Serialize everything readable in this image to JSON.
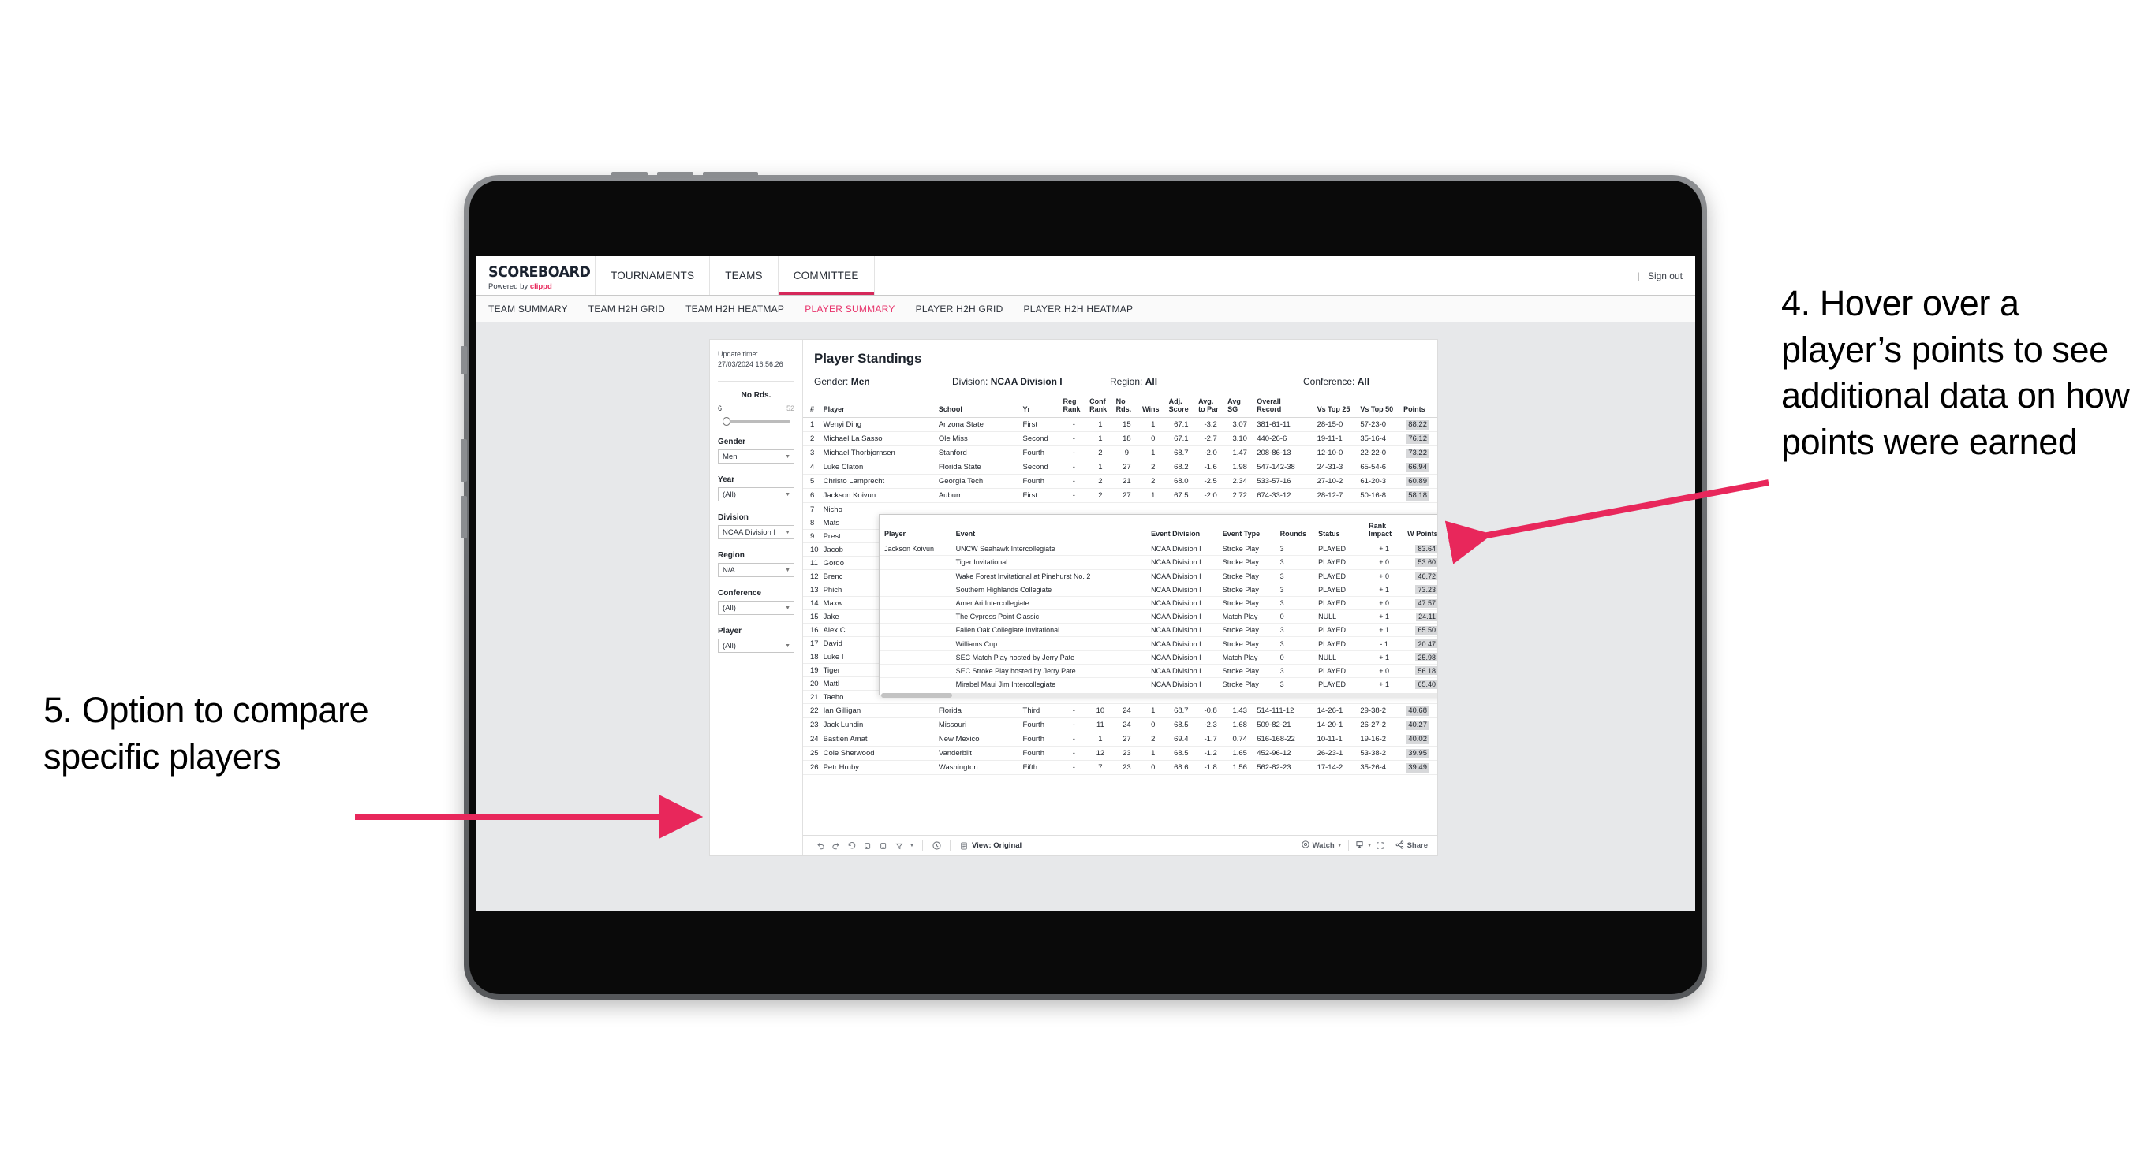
{
  "brand": {
    "title": "SCOREBOARD",
    "powered_prefix": "Powered by ",
    "powered_accent": "clippd"
  },
  "topnav": {
    "items": [
      {
        "label": "TOURNAMENTS",
        "active": false
      },
      {
        "label": "TEAMS",
        "active": false
      },
      {
        "label": "COMMITTEE",
        "active": true
      }
    ],
    "separator": "|",
    "sign_out": "Sign out"
  },
  "subnav": {
    "items": [
      {
        "label": "TEAM SUMMARY",
        "active": false
      },
      {
        "label": "TEAM H2H GRID",
        "active": false
      },
      {
        "label": "TEAM H2H HEATMAP",
        "active": false
      },
      {
        "label": "PLAYER SUMMARY",
        "active": true
      },
      {
        "label": "PLAYER H2H GRID",
        "active": false
      },
      {
        "label": "PLAYER H2H HEATMAP",
        "active": false
      }
    ]
  },
  "rail": {
    "update_time_label": "Update time:",
    "update_time_value": "27/03/2024 16:56:26",
    "slider": {
      "title": "No Rds.",
      "min": "6",
      "max": "52"
    },
    "filters": [
      {
        "label": "Gender",
        "value": "Men"
      },
      {
        "label": "Year",
        "value": "(All)"
      },
      {
        "label": "Division",
        "value": "NCAA Division I"
      },
      {
        "label": "Region",
        "value": "N/A"
      },
      {
        "label": "Conference",
        "value": "(All)"
      },
      {
        "label": "Player",
        "value": "(All)"
      }
    ]
  },
  "viz": {
    "title": "Player Standings",
    "filters": [
      {
        "label": "Gender:",
        "value": "Men"
      },
      {
        "label": "Division:",
        "value": "NCAA Division I"
      },
      {
        "label": "Region:",
        "value": "All"
      },
      {
        "label": "Conference:",
        "value": "All"
      }
    ]
  },
  "table": {
    "columns": [
      "#",
      "Player",
      "School",
      "Yr",
      "Reg\nRank",
      "Conf\nRank",
      "No\nRds.",
      "Wins",
      "Adj.\nScore",
      "Avg.\nto Par",
      "Avg\nSG",
      "Overall\nRecord",
      "Vs Top 25",
      "Vs Top 50",
      "Points"
    ],
    "rows": [
      {
        "rank": "1",
        "player": "Wenyi Ding",
        "school": "Arizona State",
        "yr": "First",
        "reg": "-",
        "conf": "1",
        "rds": "15",
        "wins": "1",
        "adj": "67.1",
        "par": "-3.2",
        "sg": "3.07",
        "record": "381-61-11",
        "t25": "28-15-0",
        "t50": "57-23-0",
        "points": "88.22"
      },
      {
        "rank": "2",
        "player": "Michael La Sasso",
        "school": "Ole Miss",
        "yr": "Second",
        "reg": "-",
        "conf": "1",
        "rds": "18",
        "wins": "0",
        "adj": "67.1",
        "par": "-2.7",
        "sg": "3.10",
        "record": "440-26-6",
        "t25": "19-11-1",
        "t50": "35-16-4",
        "points": "76.12"
      },
      {
        "rank": "3",
        "player": "Michael Thorbjornsen",
        "school": "Stanford",
        "yr": "Fourth",
        "reg": "-",
        "conf": "2",
        "rds": "9",
        "wins": "1",
        "adj": "68.7",
        "par": "-2.0",
        "sg": "1.47",
        "record": "208-86-13",
        "t25": "12-10-0",
        "t50": "22-22-0",
        "points": "73.22"
      },
      {
        "rank": "4",
        "player": "Luke Claton",
        "school": "Florida State",
        "yr": "Second",
        "reg": "-",
        "conf": "1",
        "rds": "27",
        "wins": "2",
        "adj": "68.2",
        "par": "-1.6",
        "sg": "1.98",
        "record": "547-142-38",
        "t25": "24-31-3",
        "t50": "65-54-6",
        "points": "66.94"
      },
      {
        "rank": "5",
        "player": "Christo Lamprecht",
        "school": "Georgia Tech",
        "yr": "Fourth",
        "reg": "-",
        "conf": "2",
        "rds": "21",
        "wins": "2",
        "adj": "68.0",
        "par": "-2.5",
        "sg": "2.34",
        "record": "533-57-16",
        "t25": "27-10-2",
        "t50": "61-20-3",
        "points": "60.89"
      },
      {
        "rank": "6",
        "player": "Jackson Koivun",
        "school": "Auburn",
        "yr": "First",
        "reg": "-",
        "conf": "2",
        "rds": "27",
        "wins": "1",
        "adj": "67.5",
        "par": "-2.0",
        "sg": "2.72",
        "record": "674-33-12",
        "t25": "28-12-7",
        "t50": "50-16-8",
        "points": "58.18"
      },
      {
        "rank": "7",
        "player": "Nicho",
        "school": "",
        "yr": "",
        "reg": "",
        "conf": "",
        "rds": "",
        "wins": "",
        "adj": "",
        "par": "",
        "sg": "",
        "record": "",
        "t25": "",
        "t50": "",
        "points": ""
      },
      {
        "rank": "8",
        "player": "Mats",
        "school": "",
        "yr": "",
        "reg": "",
        "conf": "",
        "rds": "",
        "wins": "",
        "adj": "",
        "par": "",
        "sg": "",
        "record": "",
        "t25": "",
        "t50": "",
        "points": ""
      },
      {
        "rank": "9",
        "player": "Prest",
        "school": "",
        "yr": "",
        "reg": "",
        "conf": "",
        "rds": "",
        "wins": "",
        "adj": "",
        "par": "",
        "sg": "",
        "record": "",
        "t25": "",
        "t50": "",
        "points": ""
      },
      {
        "rank": "10",
        "player": "Jacob",
        "school": "",
        "yr": "",
        "reg": "",
        "conf": "",
        "rds": "",
        "wins": "",
        "adj": "",
        "par": "",
        "sg": "",
        "record": "",
        "t25": "",
        "t50": "",
        "points": ""
      },
      {
        "rank": "11",
        "player": "Gordo",
        "school": "",
        "yr": "",
        "reg": "",
        "conf": "",
        "rds": "",
        "wins": "",
        "adj": "",
        "par": "",
        "sg": "",
        "record": "",
        "t25": "",
        "t50": "",
        "points": ""
      },
      {
        "rank": "12",
        "player": "Brenc",
        "school": "",
        "yr": "",
        "reg": "",
        "conf": "",
        "rds": "",
        "wins": "",
        "adj": "",
        "par": "",
        "sg": "",
        "record": "",
        "t25": "",
        "t50": "",
        "points": ""
      },
      {
        "rank": "13",
        "player": "Phich",
        "school": "",
        "yr": "",
        "reg": "",
        "conf": "",
        "rds": "",
        "wins": "",
        "adj": "",
        "par": "",
        "sg": "",
        "record": "",
        "t25": "",
        "t50": "",
        "points": ""
      },
      {
        "rank": "14",
        "player": "Maxw",
        "school": "",
        "yr": "",
        "reg": "",
        "conf": "",
        "rds": "",
        "wins": "",
        "adj": "",
        "par": "",
        "sg": "",
        "record": "",
        "t25": "",
        "t50": "",
        "points": ""
      },
      {
        "rank": "15",
        "player": "Jake I",
        "school": "",
        "yr": "",
        "reg": "",
        "conf": "",
        "rds": "",
        "wins": "",
        "adj": "",
        "par": "",
        "sg": "",
        "record": "",
        "t25": "",
        "t50": "",
        "points": ""
      },
      {
        "rank": "16",
        "player": "Alex C",
        "school": "",
        "yr": "",
        "reg": "",
        "conf": "",
        "rds": "",
        "wins": "",
        "adj": "",
        "par": "",
        "sg": "",
        "record": "",
        "t25": "",
        "t50": "",
        "points": ""
      },
      {
        "rank": "17",
        "player": "David",
        "school": "",
        "yr": "",
        "reg": "",
        "conf": "",
        "rds": "",
        "wins": "",
        "adj": "",
        "par": "",
        "sg": "",
        "record": "",
        "t25": "",
        "t50": "",
        "points": ""
      },
      {
        "rank": "18",
        "player": "Luke I",
        "school": "",
        "yr": "",
        "reg": "",
        "conf": "",
        "rds": "",
        "wins": "",
        "adj": "",
        "par": "",
        "sg": "",
        "record": "",
        "t25": "",
        "t50": "",
        "points": ""
      },
      {
        "rank": "19",
        "player": "Tiger",
        "school": "",
        "yr": "",
        "reg": "",
        "conf": "",
        "rds": "",
        "wins": "",
        "adj": "",
        "par": "",
        "sg": "",
        "record": "",
        "t25": "",
        "t50": "",
        "points": ""
      },
      {
        "rank": "20",
        "player": "Mattl",
        "school": "",
        "yr": "",
        "reg": "",
        "conf": "",
        "rds": "",
        "wins": "",
        "adj": "",
        "par": "",
        "sg": "",
        "record": "",
        "t25": "",
        "t50": "",
        "points": ""
      },
      {
        "rank": "21",
        "player": "Taeho",
        "school": "",
        "yr": "",
        "reg": "",
        "conf": "",
        "rds": "",
        "wins": "",
        "adj": "",
        "par": "",
        "sg": "",
        "record": "",
        "t25": "",
        "t50": "",
        "points": ""
      },
      {
        "rank": "22",
        "player": "Ian Gilligan",
        "school": "Florida",
        "yr": "Third",
        "reg": "-",
        "conf": "10",
        "rds": "24",
        "wins": "1",
        "adj": "68.7",
        "par": "-0.8",
        "sg": "1.43",
        "record": "514-111-12",
        "t25": "14-26-1",
        "t50": "29-38-2",
        "points": "40.68"
      },
      {
        "rank": "23",
        "player": "Jack Lundin",
        "school": "Missouri",
        "yr": "Fourth",
        "reg": "-",
        "conf": "11",
        "rds": "24",
        "wins": "0",
        "adj": "68.5",
        "par": "-2.3",
        "sg": "1.68",
        "record": "509-82-21",
        "t25": "14-20-1",
        "t50": "26-27-2",
        "points": "40.27"
      },
      {
        "rank": "24",
        "player": "Bastien Amat",
        "school": "New Mexico",
        "yr": "Fourth",
        "reg": "-",
        "conf": "1",
        "rds": "27",
        "wins": "2",
        "adj": "69.4",
        "par": "-1.7",
        "sg": "0.74",
        "record": "616-168-22",
        "t25": "10-11-1",
        "t50": "19-16-2",
        "points": "40.02"
      },
      {
        "rank": "25",
        "player": "Cole Sherwood",
        "school": "Vanderbilt",
        "yr": "Fourth",
        "reg": "-",
        "conf": "12",
        "rds": "23",
        "wins": "1",
        "adj": "68.5",
        "par": "-1.2",
        "sg": "1.65",
        "record": "452-96-12",
        "t25": "26-23-1",
        "t50": "53-38-2",
        "points": "39.95"
      },
      {
        "rank": "26",
        "player": "Petr Hruby",
        "school": "Washington",
        "yr": "Fifth",
        "reg": "-",
        "conf": "7",
        "rds": "23",
        "wins": "0",
        "adj": "68.6",
        "par": "-1.8",
        "sg": "1.56",
        "record": "562-82-23",
        "t25": "17-14-2",
        "t50": "35-26-4",
        "points": "39.49"
      }
    ]
  },
  "tooltip": {
    "columns": [
      "Player",
      "Event",
      "Event Division",
      "Event Type",
      "Rounds",
      "Status",
      "Rank\nImpact",
      "W Points"
    ],
    "player": "Jackson Koivun",
    "rows": [
      {
        "event": "UNCW Seahawk Intercollegiate",
        "division": "NCAA Division I",
        "type": "Stroke Play",
        "rounds": "3",
        "status": "PLAYED",
        "impact": "+ 1",
        "wpoints": "83.64"
      },
      {
        "event": "Tiger Invitational",
        "division": "NCAA Division I",
        "type": "Stroke Play",
        "rounds": "3",
        "status": "PLAYED",
        "impact": "+ 0",
        "wpoints": "53.60"
      },
      {
        "event": "Wake Forest Invitational at Pinehurst No. 2",
        "division": "NCAA Division I",
        "type": "Stroke Play",
        "rounds": "3",
        "status": "PLAYED",
        "impact": "+ 0",
        "wpoints": "46.72"
      },
      {
        "event": "Southern Highlands Collegiate",
        "division": "NCAA Division I",
        "type": "Stroke Play",
        "rounds": "3",
        "status": "PLAYED",
        "impact": "+ 1",
        "wpoints": "73.23"
      },
      {
        "event": "Amer Ari Intercollegiate",
        "division": "NCAA Division I",
        "type": "Stroke Play",
        "rounds": "3",
        "status": "PLAYED",
        "impact": "+ 0",
        "wpoints": "47.57"
      },
      {
        "event": "The Cypress Point Classic",
        "division": "NCAA Division I",
        "type": "Match Play",
        "rounds": "0",
        "status": "NULL",
        "impact": "+ 1",
        "wpoints": "24.11"
      },
      {
        "event": "Fallen Oak Collegiate Invitational",
        "division": "NCAA Division I",
        "type": "Stroke Play",
        "rounds": "3",
        "status": "PLAYED",
        "impact": "+ 1",
        "wpoints": "65.50"
      },
      {
        "event": "Williams Cup",
        "division": "NCAA Division I",
        "type": "Stroke Play",
        "rounds": "3",
        "status": "PLAYED",
        "impact": "- 1",
        "wpoints": "20.47"
      },
      {
        "event": "SEC Match Play hosted by Jerry Pate",
        "division": "NCAA Division I",
        "type": "Match Play",
        "rounds": "0",
        "status": "NULL",
        "impact": "+ 1",
        "wpoints": "25.98"
      },
      {
        "event": "SEC Stroke Play hosted by Jerry Pate",
        "division": "NCAA Division I",
        "type": "Stroke Play",
        "rounds": "3",
        "status": "PLAYED",
        "impact": "+ 0",
        "wpoints": "56.18"
      },
      {
        "event": "Mirabel Maui Jim Intercollegiate",
        "division": "NCAA Division I",
        "type": "Stroke Play",
        "rounds": "3",
        "status": "PLAYED",
        "impact": "+ 1",
        "wpoints": "65.40"
      }
    ]
  },
  "toolbar": {
    "view_label": "View: Original",
    "watch_label": "Watch",
    "share_label": "Share"
  },
  "annotations": {
    "item4": "4. Hover over a player’s points to see additional data on how points were earned",
    "item5": "5. Option to compare specific players"
  },
  "colors": {
    "accent_pink": "#e8275b",
    "arrow_pink": "#e8275b",
    "workspace_bg": "#e7e8ea"
  }
}
